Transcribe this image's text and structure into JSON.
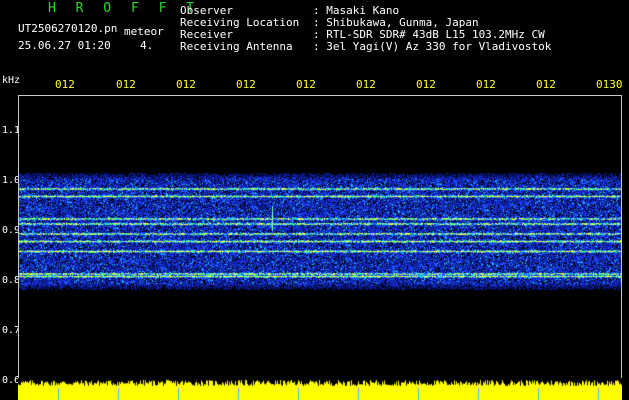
{
  "header": {
    "station": "H R O F F T",
    "filename": "UT2506270120.pn",
    "mode": "meteor",
    "datetime": "25.06.27 01:20",
    "count": "4.",
    "observer_label": "Observer",
    "observer_value": ": Masaki Kano",
    "location_label": "Receiving Location",
    "location_value": ": Shibukawa, Gunma, Japan",
    "receiver_label": "Receiver",
    "receiver_value": ": RTL-SDR SDR# 43dB L15 103.2MHz CW",
    "antenna_label": "Receiving Antenna",
    "antenna_value": ": 3el Yagi(V) Az 330 for Vladivostok"
  },
  "axis": {
    "unit": "kHz",
    "time_ticks": [
      "012",
      "012",
      "012",
      "012",
      "012",
      "012",
      "012",
      "012",
      "012",
      "0130"
    ],
    "freq_ticks": [
      "1.1",
      "1.0",
      "0.9",
      "0.8",
      "0.7",
      "0.6"
    ]
  },
  "colors": {
    "header_green": "#2ed62e",
    "tick_yellow": "#ffff22",
    "noise_blue": "#1c2fd0",
    "power_yellow": "#ffff00"
  },
  "spectrogram": {
    "band_khz": [
      0.78,
      1.02
    ],
    "lines_khz": [
      0.985,
      0.97,
      0.925,
      0.915,
      0.895,
      0.88,
      0.86,
      0.815,
      0.81
    ],
    "meteor_ping_time_fraction": 0.42
  }
}
